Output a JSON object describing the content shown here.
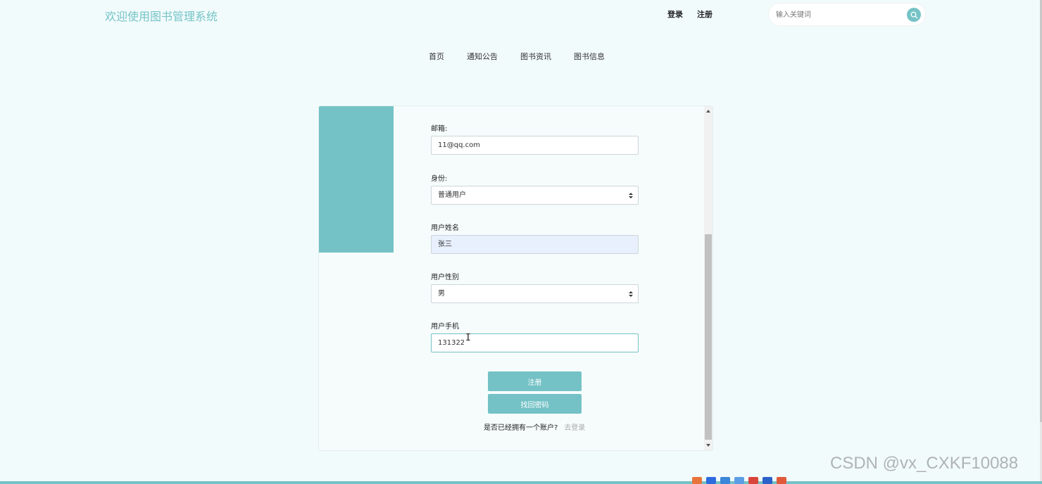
{
  "header": {
    "site_title": "欢迎使用图书管理系统",
    "login_label": "登录",
    "register_label": "注册",
    "search_placeholder": "输入关键词",
    "search_icon": "search-icon"
  },
  "nav": [
    "首页",
    "通知公告",
    "图书资讯",
    "图书信息"
  ],
  "form": {
    "email_label": "邮箱:",
    "email_value": "11@qq.com",
    "role_label": "身份:",
    "role_value": "普通用户",
    "name_label": "用户姓名",
    "name_value": "张三",
    "gender_label": "用户性别",
    "gender_value": "男",
    "phone_label": "用户手机",
    "phone_value": "131322",
    "register_button": "注册",
    "recover_button": "找回密码",
    "have_account_text": "是否已经拥有一个账户?",
    "go_login_link": "去登录"
  },
  "watermark": "CSDN @vx_CXKF10088",
  "colors": {
    "accent": "#74c2c6",
    "page_bg": "#f2fbfc",
    "filled_field_bg": "#e8f0fd"
  }
}
